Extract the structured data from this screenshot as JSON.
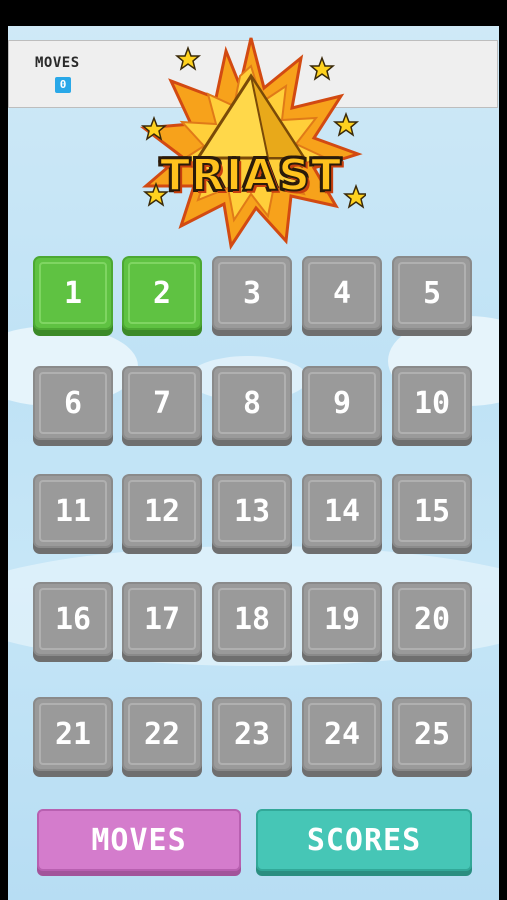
{
  "header": {
    "moves_label": "MOVES",
    "moves_value": "0"
  },
  "logo": {
    "text": "TRIAST"
  },
  "levels": [
    {
      "label": "1",
      "unlocked": true
    },
    {
      "label": "2",
      "unlocked": true
    },
    {
      "label": "3",
      "unlocked": false
    },
    {
      "label": "4",
      "unlocked": false
    },
    {
      "label": "5",
      "unlocked": false
    },
    {
      "label": "6",
      "unlocked": false
    },
    {
      "label": "7",
      "unlocked": false
    },
    {
      "label": "8",
      "unlocked": false
    },
    {
      "label": "9",
      "unlocked": false
    },
    {
      "label": "10",
      "unlocked": false
    },
    {
      "label": "11",
      "unlocked": false
    },
    {
      "label": "12",
      "unlocked": false
    },
    {
      "label": "13",
      "unlocked": false
    },
    {
      "label": "14",
      "unlocked": false
    },
    {
      "label": "15",
      "unlocked": false
    },
    {
      "label": "16",
      "unlocked": false
    },
    {
      "label": "17",
      "unlocked": false
    },
    {
      "label": "18",
      "unlocked": false
    },
    {
      "label": "19",
      "unlocked": false
    },
    {
      "label": "20",
      "unlocked": false
    },
    {
      "label": "21",
      "unlocked": false
    },
    {
      "label": "22",
      "unlocked": false
    },
    {
      "label": "23",
      "unlocked": false
    },
    {
      "label": "24",
      "unlocked": false
    },
    {
      "label": "25",
      "unlocked": false
    }
  ],
  "buttons": {
    "moves": "MOVES",
    "scores": "SCORES"
  },
  "colors": {
    "unlocked_tile": "#5fc242",
    "locked_tile": "#9a9a9a",
    "moves_button": "#d47ccc",
    "scores_button": "#46c6b6",
    "sky": "#c6e6f7"
  }
}
